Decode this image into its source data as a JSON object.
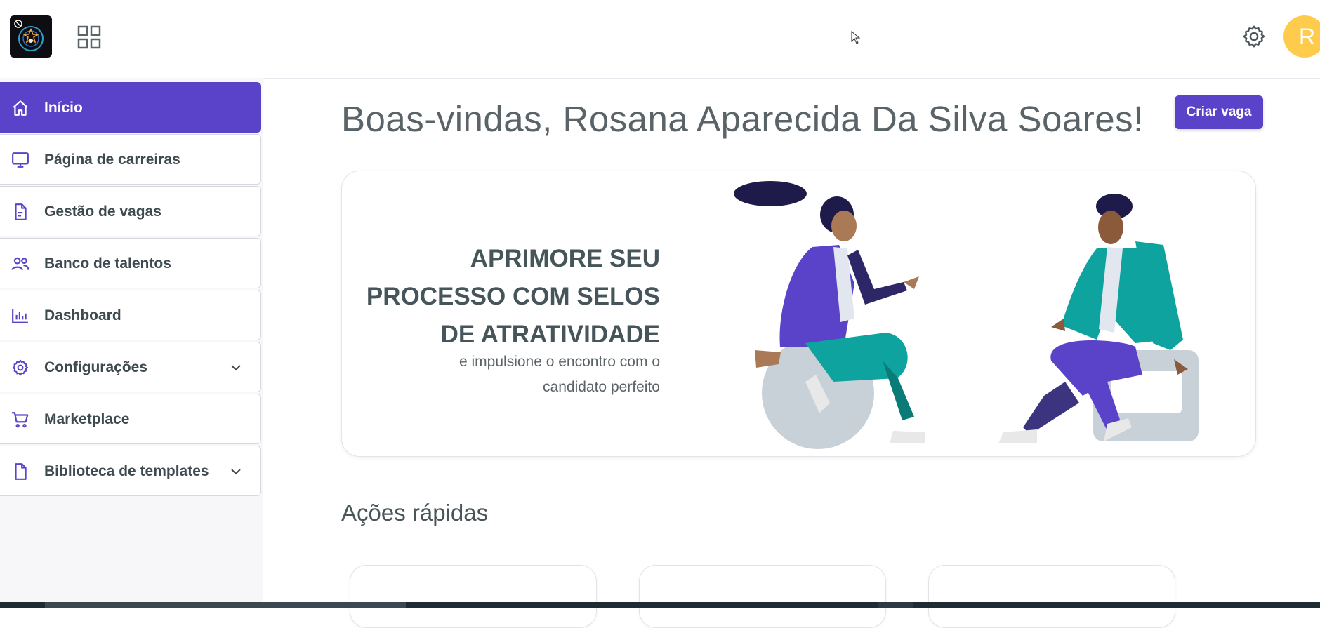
{
  "header": {
    "avatar_initial": "R",
    "icons": [
      "app-logo",
      "apps-grid-icon",
      "gear-icon"
    ]
  },
  "sidebar": {
    "items": [
      {
        "label": "Início",
        "icon": "home-icon",
        "active": true
      },
      {
        "label": "Página de carreiras",
        "icon": "monitor-icon"
      },
      {
        "label": "Gestão de vagas",
        "icon": "document-icon"
      },
      {
        "label": "Banco de talentos",
        "icon": "users-icon"
      },
      {
        "label": "Dashboard",
        "icon": "bar-chart-icon"
      },
      {
        "label": "Configurações",
        "icon": "gear-icon",
        "expandable": true
      },
      {
        "label": "Marketplace",
        "icon": "cart-icon"
      },
      {
        "label": "Biblioteca de templates",
        "icon": "file-icon",
        "expandable": true
      }
    ]
  },
  "main": {
    "welcome": "Boas-vindas, Rosana Aparecida Da Silva Soares!",
    "create_button": "Criar vaga",
    "banner": {
      "title_lines": [
        "APRIMORE SEU",
        "PROCESSO COM SELOS",
        "DE ATRATIVIDADE"
      ],
      "subtitle_lines": [
        "e impulsione o encontro com o",
        "candidato perfeito"
      ]
    },
    "quick_actions_title": "Ações rápidas"
  },
  "colors": {
    "primary": "#5b43c9",
    "avatar": "#fecb4c",
    "text": "#3d4a4f",
    "teal": "#0fa3a0"
  }
}
